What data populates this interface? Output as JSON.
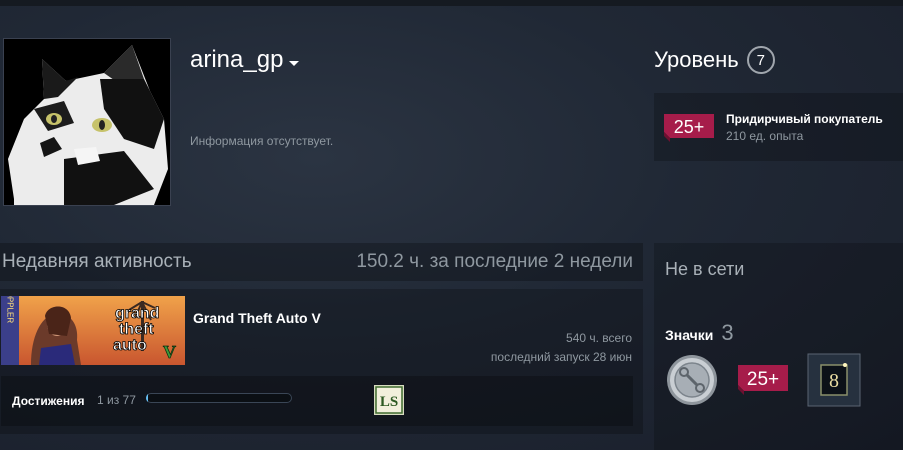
{
  "profile": {
    "username": "arina_gp",
    "summary": "Информация отсутствует."
  },
  "level": {
    "label": "Уровень",
    "value": "7"
  },
  "favorite_badge": {
    "icon_text": "25+",
    "name": "Придирчивый покупатель",
    "xp": "210 ед. опыта"
  },
  "recent_activity": {
    "title": "Недавняя активность",
    "hours_summary": "150.2 ч. за последние 2 недели",
    "game": {
      "name": "Grand Theft Auto V",
      "capsule_lines": [
        "grand",
        "theft",
        "auto"
      ],
      "capsule_side_text": "DOPPLER",
      "capsule_numeral": "V",
      "hours_total": "540 ч. всего",
      "last_played": "последний запуск 28 июн",
      "achievements": {
        "label": "Достижения",
        "count": "1 из 77",
        "progress": 0.013,
        "icon_text": "LS"
      }
    }
  },
  "sidebar": {
    "status": "Не в сети",
    "badges_label": "Значки",
    "badges_count": "3",
    "badges": [
      {
        "icon": "silver-coin-badge-icon"
      },
      {
        "icon": "25-plus-badge-icon",
        "text": "25+"
      },
      {
        "icon": "8-badge-icon",
        "text": "8"
      }
    ]
  },
  "colors": {
    "accent_blue": "#66c0f4",
    "badge_pink": "#a61c4a",
    "muted_text": "#8f98a0"
  }
}
